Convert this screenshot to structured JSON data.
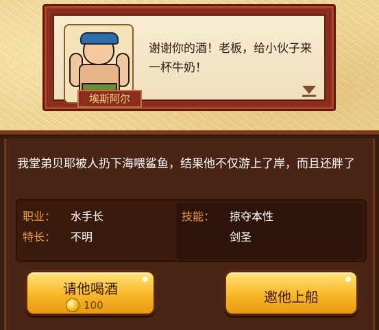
{
  "dialog": {
    "npc_name": "埃斯阿尔",
    "text": "谢谢你的酒！老板，给小伙子来一杯牛奶！"
  },
  "description": "我堂弟贝耶被人扔下海喂鲨鱼，结果他不仅游上了岸，而且还胖了",
  "stats": {
    "job_label": "职业：",
    "job_value": "水手长",
    "specialty_label": "特长：",
    "specialty_value": "不明",
    "skill_label": "技能：",
    "skills": [
      "掠夺本性",
      "剑圣"
    ]
  },
  "buttons": {
    "drink_label": "请他喝酒",
    "drink_cost": "100",
    "invite_label": "邀他上船"
  },
  "colors": {
    "label_orange": "#f0a040",
    "button_gold": "#f7b827",
    "frame_red": "#8a2d1c"
  }
}
